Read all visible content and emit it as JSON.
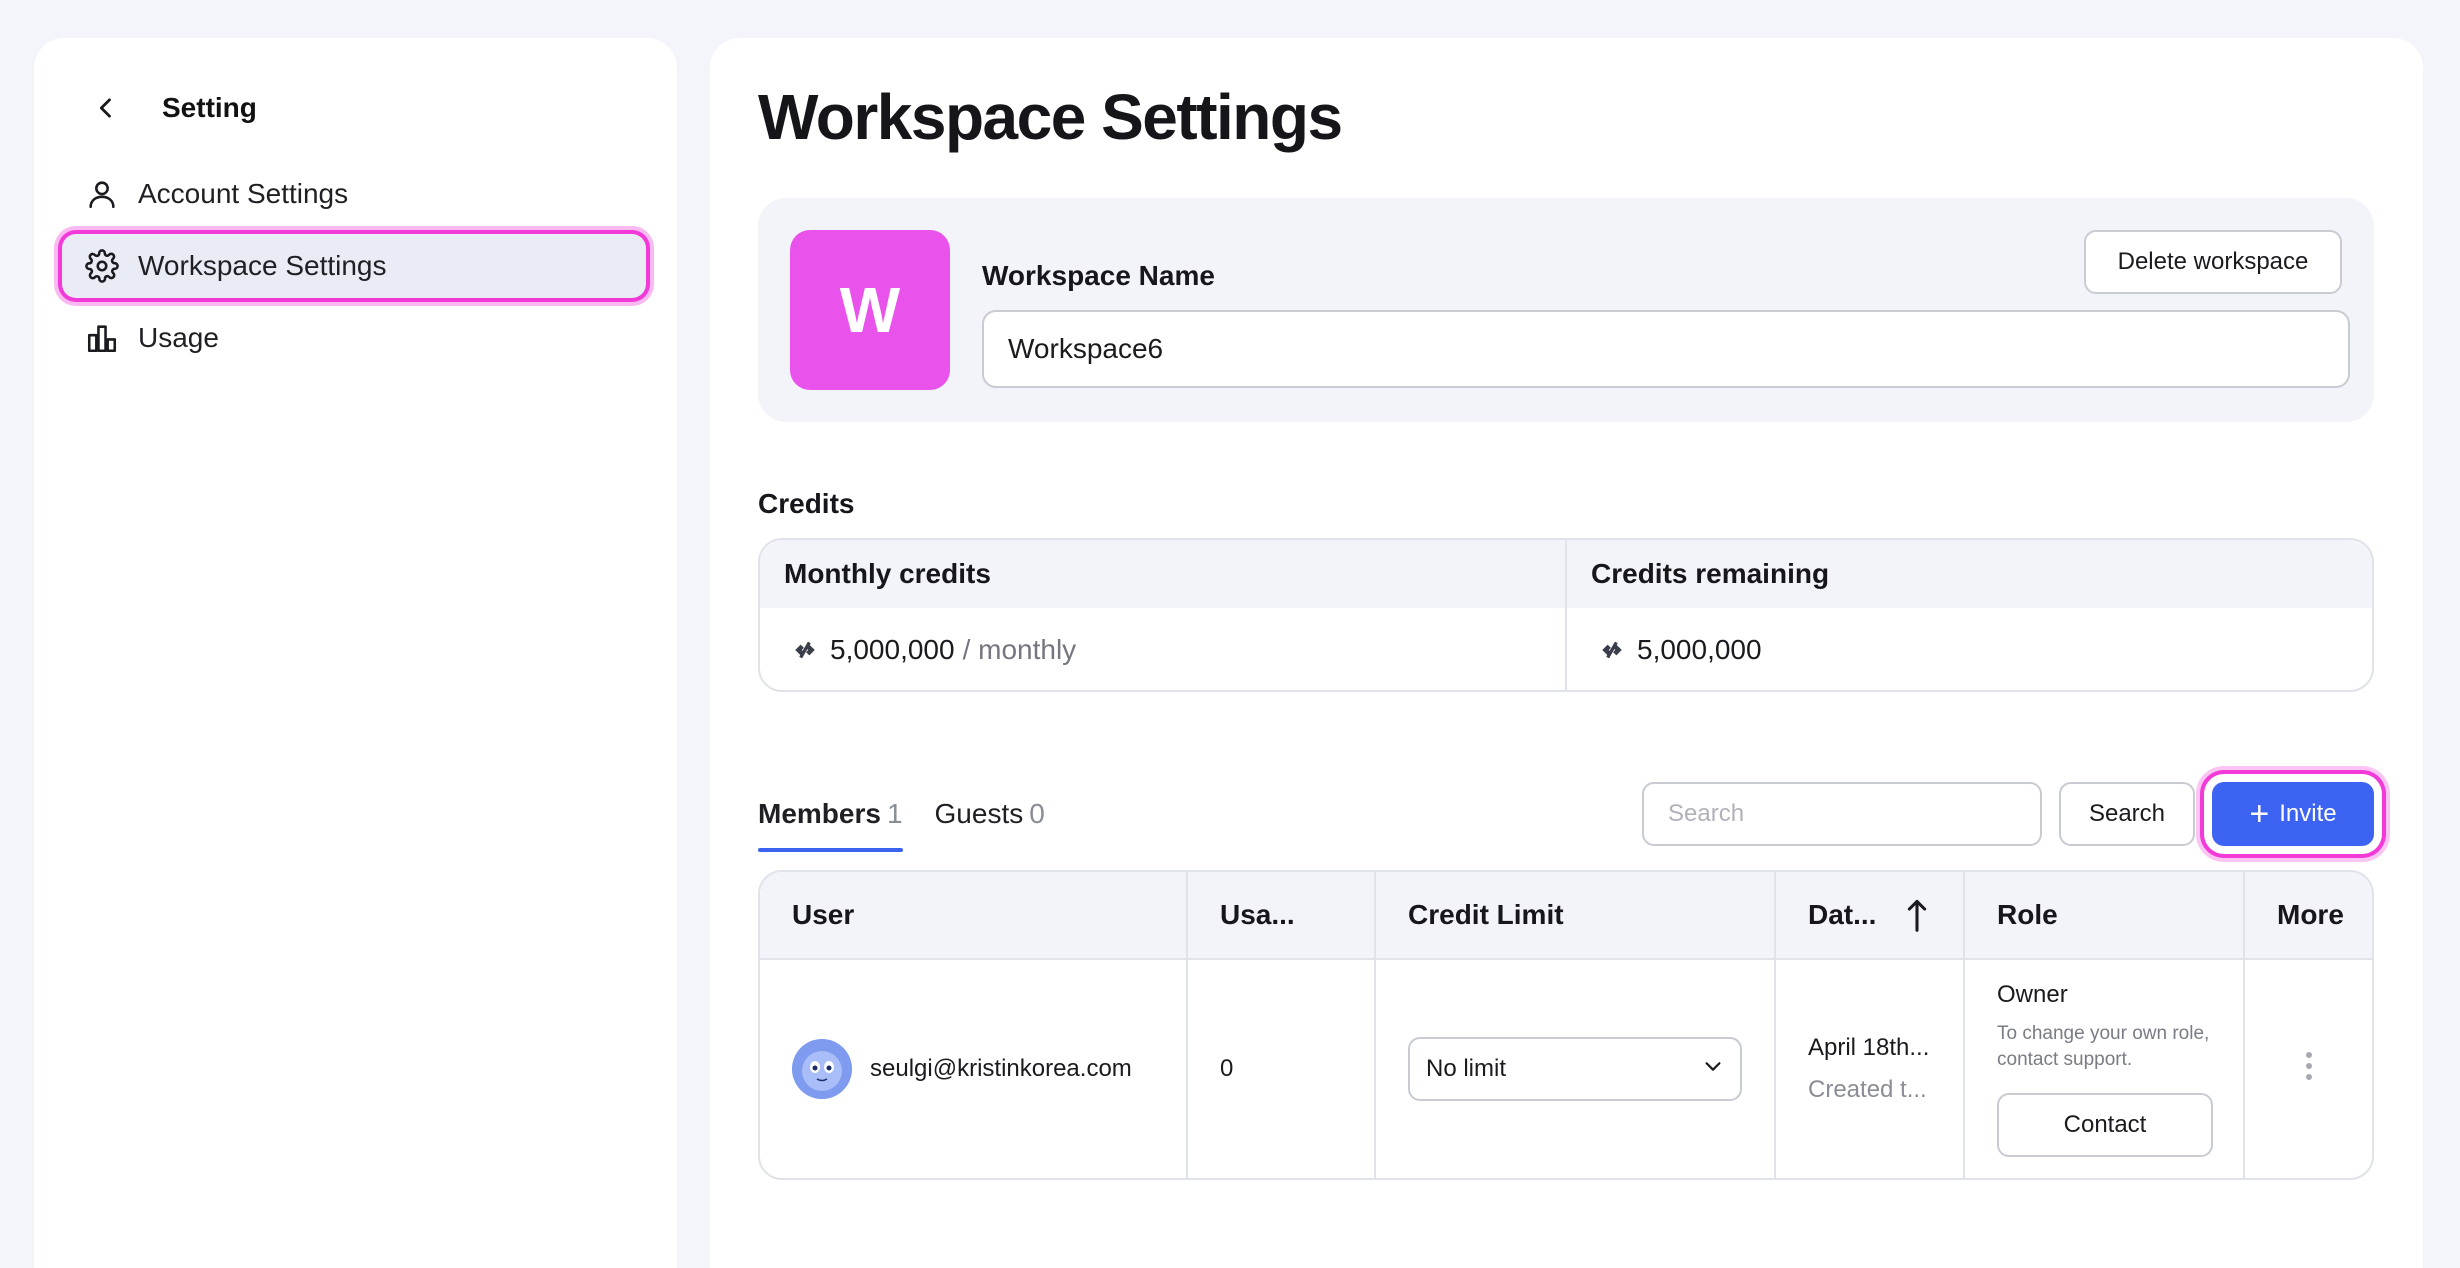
{
  "sidebar": {
    "title": "Setting",
    "items": [
      {
        "label": "Account Settings",
        "icon": "user-icon"
      },
      {
        "label": "Workspace Settings",
        "icon": "gear-icon"
      },
      {
        "label": "Usage",
        "icon": "bar-chart-icon"
      }
    ]
  },
  "main": {
    "title": "Workspace Settings",
    "workspace": {
      "avatar_letter": "W",
      "avatar_color": "#ea52ec",
      "name_label": "Workspace Name",
      "name_value": "Workspace6",
      "delete_label": "Delete workspace"
    },
    "credits": {
      "title": "Credits",
      "monthly_label": "Monthly credits",
      "monthly_value": "5,000,000",
      "monthly_suffix": "/ monthly",
      "remaining_label": "Credits remaining",
      "remaining_value": "5,000,000"
    },
    "tabs": [
      {
        "label": "Members",
        "count": "1",
        "active": true
      },
      {
        "label": "Guests",
        "count": "0",
        "active": false
      }
    ],
    "toolbar": {
      "search_placeholder": "Search",
      "search_button": "Search",
      "invite_button": "Invite",
      "accent_color": "#3d63f3"
    },
    "table": {
      "headers": [
        "User",
        "Usa...",
        "Credit Limit",
        "Dat...",
        "Role",
        "More"
      ],
      "rows": [
        {
          "email": "seulgi@kristinkorea.com",
          "usage": "0",
          "credit_limit": "No limit",
          "date": "April 18th...",
          "date_sub": "Created t...",
          "role": "Owner",
          "role_hint": "To change your own role, contact support.",
          "contact_label": "Contact"
        }
      ]
    }
  },
  "highlight_color": "#f13ad8"
}
